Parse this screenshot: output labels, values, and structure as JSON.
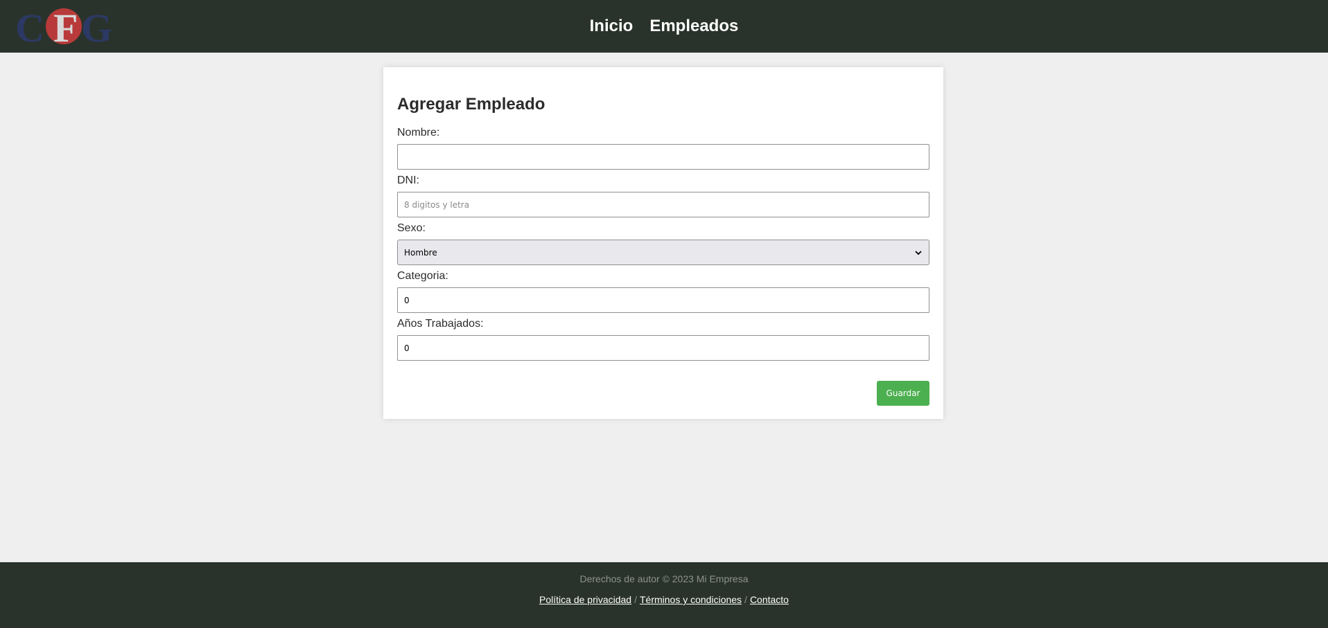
{
  "logo": {
    "text": "CFG",
    "colors": {
      "letters": "#2d3a6b",
      "circle": "#b83a3a",
      "f_letter": "#d9d9d9"
    }
  },
  "nav": {
    "items": [
      {
        "label": "Inicio"
      },
      {
        "label": "Empleados"
      }
    ]
  },
  "form": {
    "title": "Agregar Empleado",
    "nombre": {
      "label": "Nombre:",
      "value": ""
    },
    "dni": {
      "label": "DNI:",
      "placeholder": "8 digitos y letra"
    },
    "sexo": {
      "label": "Sexo:",
      "selected": "Hombre"
    },
    "categoria": {
      "label": "Categoria:",
      "value": "0"
    },
    "anos": {
      "label": "Años Trabajados:",
      "value": "0"
    },
    "save_label": "Guardar"
  },
  "footer": {
    "copyright": "Derechos de autor © 2023 Mi Empresa",
    "links": [
      {
        "label": "Política de privacidad"
      },
      {
        "label": "Términos y condiciones"
      },
      {
        "label": "Contacto"
      }
    ],
    "separator": "/"
  },
  "colors": {
    "header_bg": "#29332b",
    "page_bg": "#efefef",
    "accent": "#4caf50"
  }
}
